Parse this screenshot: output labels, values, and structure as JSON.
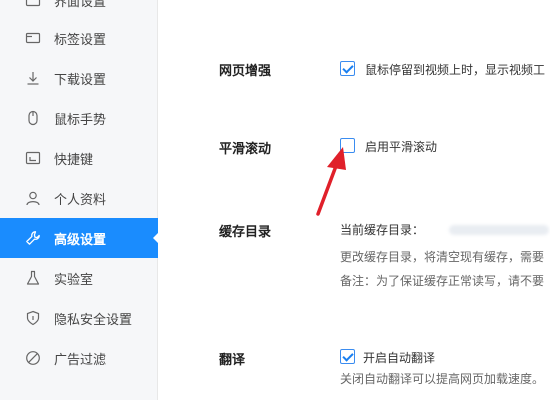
{
  "sidebar": {
    "items": [
      {
        "label": "界面设置",
        "icon": "window-icon"
      },
      {
        "label": "标签设置",
        "icon": "tab-icon"
      },
      {
        "label": "下载设置",
        "icon": "download-icon"
      },
      {
        "label": "鼠标手势",
        "icon": "mouse-icon"
      },
      {
        "label": "快捷键",
        "icon": "keyboard-icon"
      },
      {
        "label": "个人资料",
        "icon": "user-icon"
      },
      {
        "label": "高级设置",
        "icon": "wrench-icon",
        "active": true
      },
      {
        "label": "实验室",
        "icon": "flask-icon"
      },
      {
        "label": "隐私安全设置",
        "icon": "shield-icon"
      },
      {
        "label": "广告过滤",
        "icon": "block-icon"
      }
    ]
  },
  "main": {
    "web_enhance": {
      "title": "网页增强",
      "option": "鼠标停留到视频上时，显示视频工",
      "checked": true
    },
    "smooth_scroll": {
      "title": "平滑滚动",
      "option": "启用平滑滚动",
      "checked": false
    },
    "cache_dir": {
      "title": "缓存目录",
      "current_label": "当前缓存目录：",
      "change_note": "更改缓存目录，将清空现有缓存，需要",
      "remark": "备注：为了保证缓存正常读写，请不要"
    },
    "translate": {
      "title": "翻译",
      "option": "开启自动翻译",
      "checked": true,
      "note": "关闭自动翻译可以提高网页加载速度。"
    }
  },
  "colors": {
    "accent": "#1a8cfe",
    "annotation_arrow": "#e0202a"
  }
}
